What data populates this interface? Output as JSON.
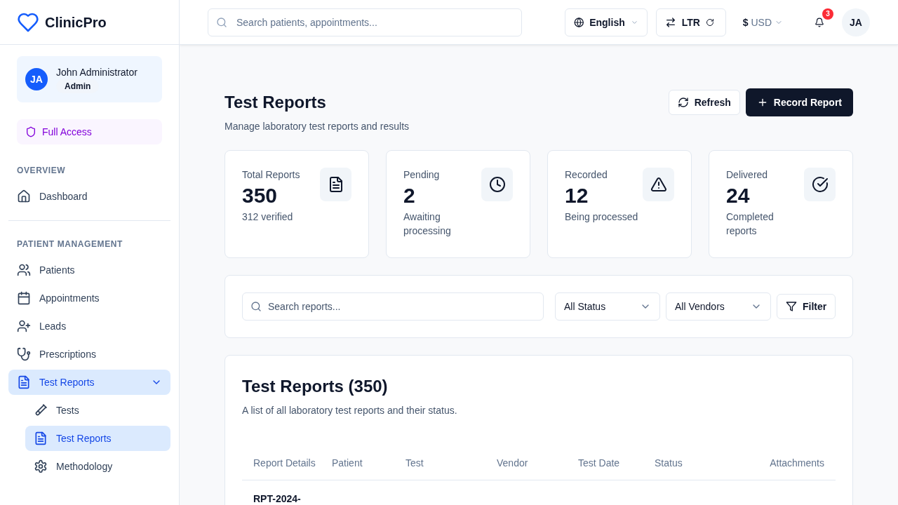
{
  "app": {
    "name": "ClinicPro"
  },
  "user": {
    "initials": "JA",
    "name": "John Administrator",
    "role": "Admin"
  },
  "access": {
    "label": "Full Access"
  },
  "sidebar": {
    "sections": [
      {
        "title": "OVERVIEW",
        "items": [
          {
            "label": "Dashboard",
            "selected": false
          }
        ]
      },
      {
        "title": "PATIENT MANAGEMENT",
        "items": [
          {
            "label": "Patients",
            "selected": false
          },
          {
            "label": "Appointments",
            "selected": false
          },
          {
            "label": "Leads",
            "selected": false
          },
          {
            "label": "Prescriptions",
            "selected": false
          },
          {
            "label": "Test Reports",
            "selected": true,
            "expanded": true,
            "children": [
              {
                "label": "Tests",
                "selected": false
              },
              {
                "label": "Test Reports",
                "selected": true
              },
              {
                "label": "Methodology",
                "selected": false
              }
            ]
          }
        ]
      }
    ]
  },
  "header": {
    "search": {
      "placeholder": "Search patients, appointments..."
    },
    "language": "English",
    "direction": "LTR",
    "currency_symbol": "$",
    "currency_code": "USD",
    "notifications": "3",
    "avatar": "JA"
  },
  "page": {
    "title": "Test Reports",
    "subtitle": "Manage laboratory test reports and results",
    "buttons": [
      {
        "label": "Refresh",
        "kind": "outline"
      },
      {
        "label": "Record Report",
        "kind": "primary"
      }
    ]
  },
  "stats": [
    {
      "label": "Total Reports",
      "value": "350",
      "note": "312 verified"
    },
    {
      "label": "Pending",
      "value": "2",
      "note": "Awaiting processing"
    },
    {
      "label": "Recorded",
      "value": "12",
      "note": "Being processed"
    },
    {
      "label": "Delivered",
      "value": "24",
      "note": "Completed reports"
    }
  ],
  "filters": {
    "search": {
      "placeholder": "Search reports..."
    },
    "status": "All Status",
    "vendor": "All Vendors",
    "button": "Filter"
  },
  "table": {
    "title": "Test Reports (350)",
    "subtitle": "A list of all laboratory test reports and their status.",
    "columns": [
      "Report Details",
      "Patient",
      "Test",
      "Vendor",
      "Test Date",
      "Status",
      "Attachments"
    ],
    "rows": [
      {
        "report_details": "RPT-2024-"
      }
    ]
  }
}
